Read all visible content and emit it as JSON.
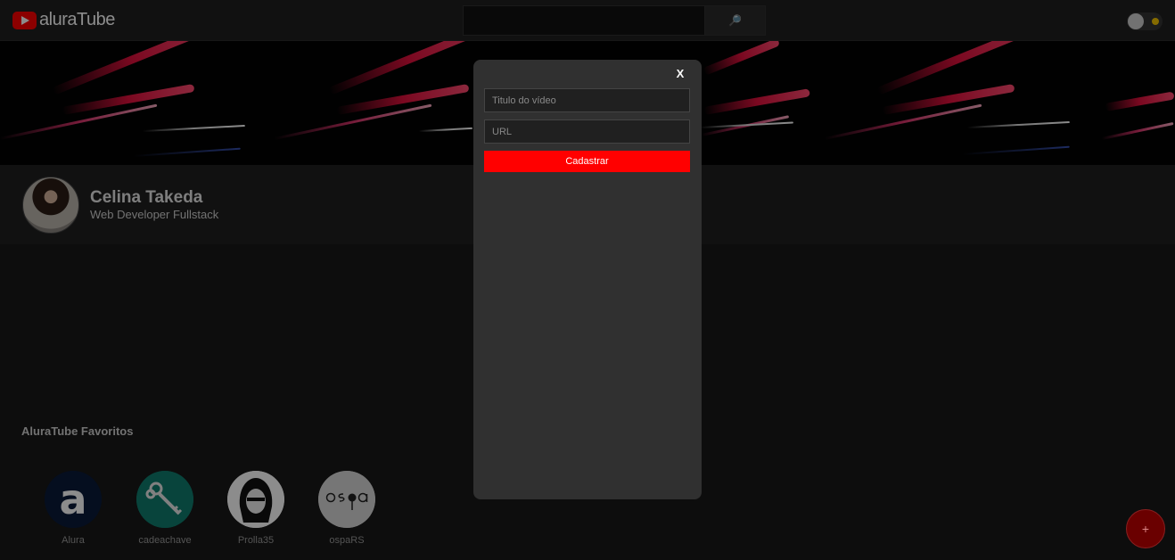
{
  "header": {
    "logo_text": "aluraTube",
    "search": {
      "value": "",
      "placeholder": "",
      "button_icon": "🔎"
    },
    "theme_toggle": {
      "knob_icon": "knob",
      "sun_icon": "sun-icon",
      "sun_color": "#f2c400"
    }
  },
  "profile": {
    "name": "Celina Takeda",
    "role": "Web Developer Fullstack"
  },
  "favorites": {
    "title": "AluraTube Favoritos",
    "items": [
      {
        "name": "Alura",
        "color": "#0a1a3a"
      },
      {
        "name": "cadeachave",
        "color": "#0f7c6e"
      },
      {
        "name": "Prolla35",
        "color": "#ffffff"
      },
      {
        "name": "ospaRS",
        "color": "#d8d8d8"
      }
    ]
  },
  "add_button": {
    "label": "+"
  },
  "modal": {
    "close_label": "X",
    "title_field": {
      "value": "",
      "placeholder": "Titulo do vídeo"
    },
    "url_field": {
      "value": "",
      "placeholder": "URL"
    },
    "submit_label": "Cadastrar"
  },
  "colors": {
    "accent": "#ff0000",
    "background": "#181818",
    "modal_bg": "#303030"
  }
}
